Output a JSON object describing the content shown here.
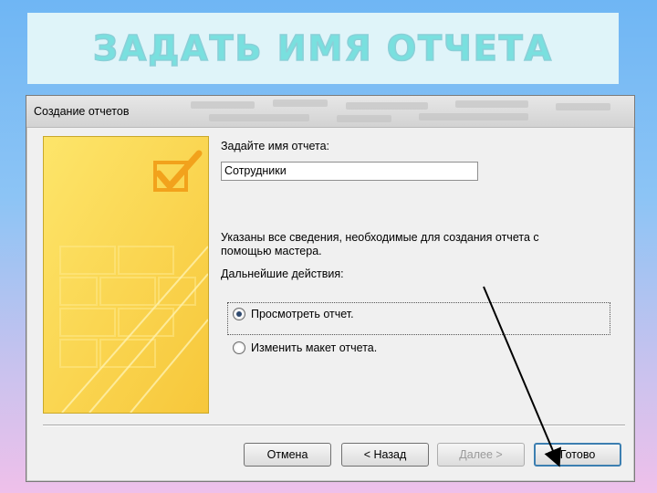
{
  "slide": {
    "title": "ЗАДАТЬ ИМЯ ОТЧЕТА"
  },
  "dialog": {
    "title": "Создание отчетов",
    "name_prompt": "Задайте имя отчета:",
    "report_name_value": "Сотрудники",
    "info_line1": "Указаны все сведения, необходимые для создания отчета с",
    "info_line2": "помощью мастера.",
    "next_actions_label": "Дальнейшие действия:",
    "options": [
      {
        "label": "Просмотреть отчет.",
        "checked": true
      },
      {
        "label": "Изменить макет отчета.",
        "checked": false
      }
    ],
    "buttons": {
      "cancel": "Отмена",
      "back": "< Назад",
      "next": "Далее >",
      "finish": "Готово"
    }
  },
  "colors": {
    "title_text": "#79e0df",
    "title_band": "#dff4f9",
    "wizard_panel": "#fbd94b",
    "default_button_border": "#3c7fb1"
  },
  "icons": [
    "checkbox-check-icon",
    "annotation-arrow-icon"
  ]
}
